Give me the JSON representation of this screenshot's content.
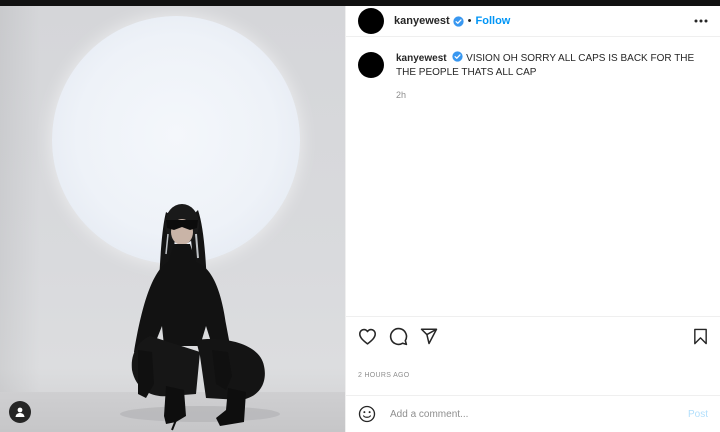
{
  "header": {
    "username": "kanyewest",
    "separator": "•",
    "follow_label": "Follow"
  },
  "caption": {
    "username": "kanyewest",
    "text": "VISION OH SORRY ALL CAPS IS BACK FOR THE THE PEOPLE THATS ALL CAP",
    "age": "2h"
  },
  "post": {
    "timestamp": "2 HOURS AGO"
  },
  "comment_box": {
    "placeholder": "Add a comment...",
    "post_label": "Post"
  },
  "icons": {
    "verified": "verified-badge-icon",
    "more": "more-options-icon",
    "like": "heart-icon",
    "comment": "comment-bubble-icon",
    "share": "paper-plane-icon",
    "save": "bookmark-icon",
    "emoji": "emoji-smiley-icon",
    "tag": "user-tag-icon"
  },
  "colors": {
    "accent": "#0095f6",
    "verified": "#3897f0",
    "post_disabled": "#b2dffc",
    "muted_text": "#8e8e8e"
  }
}
